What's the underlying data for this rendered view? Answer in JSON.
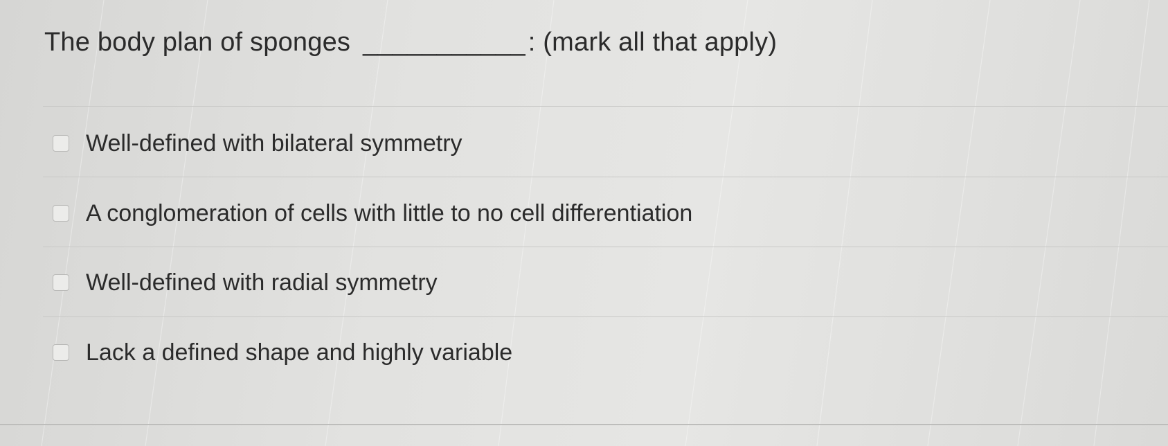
{
  "question": {
    "prefix": "The body plan of sponges",
    "blank": "___________",
    "suffix": ": (mark all that apply)"
  },
  "options": [
    {
      "label": "Well-defined with bilateral symmetry",
      "checked": false
    },
    {
      "label": "A conglomeration of cells with little to no cell differentiation",
      "checked": false
    },
    {
      "label": "Well-defined with radial symmetry",
      "checked": false
    },
    {
      "label": "Lack a defined shape and highly variable",
      "checked": false
    }
  ]
}
